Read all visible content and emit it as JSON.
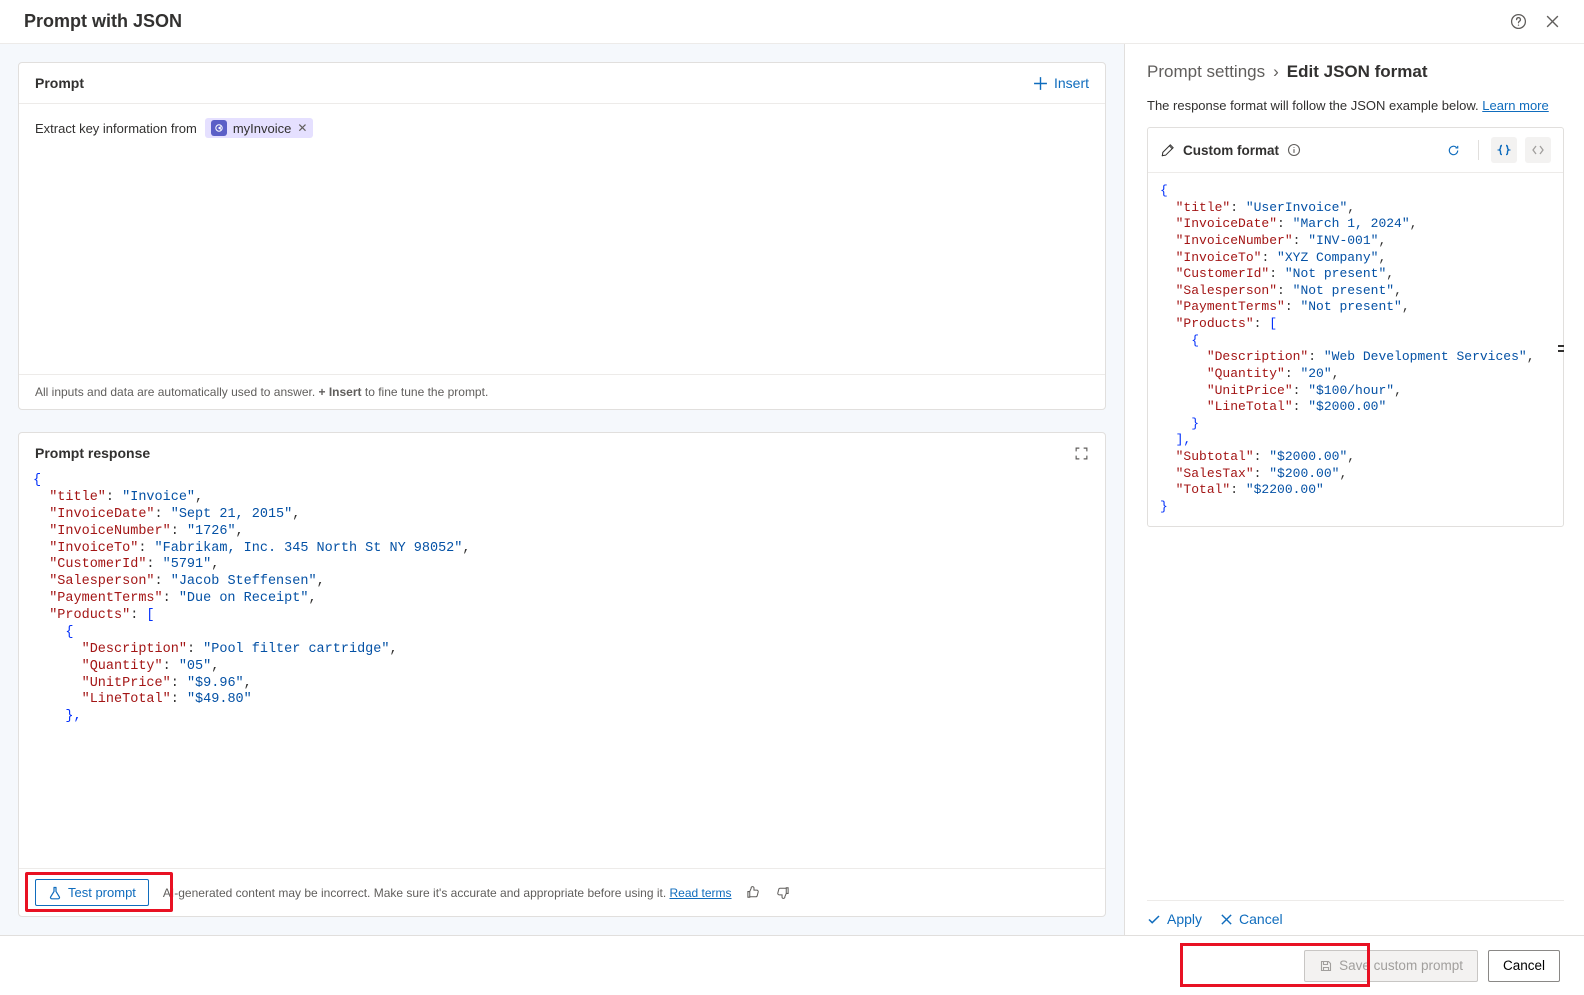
{
  "header": {
    "title": "Prompt with JSON"
  },
  "prompt": {
    "section_title": "Prompt",
    "insert_label": "Insert",
    "text_prefix": "Extract key information from",
    "chip_label": "myInvoice",
    "footer_pre": "All inputs and data are automatically used to answer. ",
    "footer_bold": "+ Insert",
    "footer_post": " to fine tune the prompt."
  },
  "response": {
    "section_title": "Prompt response",
    "test_button": "Test prompt",
    "disclaimer": "AI-generated content may be incorrect. Make sure it's accurate and appropriate before using it. ",
    "read_terms": "Read terms",
    "json_lines": [
      {
        "ind": 0,
        "t": "br",
        "v": "{"
      },
      {
        "ind": 1,
        "t": "kv",
        "k": "title",
        "v": "Invoice",
        "c": true
      },
      {
        "ind": 1,
        "t": "kv",
        "k": "InvoiceDate",
        "v": "Sept 21, 2015",
        "c": true
      },
      {
        "ind": 1,
        "t": "kv",
        "k": "InvoiceNumber",
        "v": "1726",
        "c": true
      },
      {
        "ind": 1,
        "t": "kv",
        "k": "InvoiceTo",
        "v": "Fabrikam, Inc. 345 North St NY 98052",
        "c": true
      },
      {
        "ind": 1,
        "t": "kv",
        "k": "CustomerId",
        "v": "5791",
        "c": true
      },
      {
        "ind": 1,
        "t": "kv",
        "k": "Salesperson",
        "v": "Jacob Steffensen",
        "c": true
      },
      {
        "ind": 1,
        "t": "kv",
        "k": "PaymentTerms",
        "v": "Due on Receipt",
        "c": true
      },
      {
        "ind": 1,
        "t": "karr",
        "k": "Products"
      },
      {
        "ind": 2,
        "t": "br",
        "v": "{"
      },
      {
        "ind": 3,
        "t": "kv",
        "k": "Description",
        "v": "Pool filter cartridge",
        "c": true
      },
      {
        "ind": 3,
        "t": "kv",
        "k": "Quantity",
        "v": "05",
        "c": true
      },
      {
        "ind": 3,
        "t": "kv",
        "k": "UnitPrice",
        "v": "$9.96",
        "c": true
      },
      {
        "ind": 3,
        "t": "kv",
        "k": "LineTotal",
        "v": "$49.80"
      },
      {
        "ind": 2,
        "t": "br",
        "v": "},"
      }
    ]
  },
  "right": {
    "breadcrumb_parent": "Prompt settings",
    "breadcrumb_current": "Edit JSON format",
    "desc": "The response format will follow the JSON example below. ",
    "learn_more": "Learn more",
    "format_title": "Custom format",
    "json_lines": [
      {
        "ind": 0,
        "t": "br",
        "v": "{"
      },
      {
        "ind": 1,
        "t": "kv",
        "k": "title",
        "v": "UserInvoice",
        "c": true
      },
      {
        "ind": 1,
        "t": "kv",
        "k": "InvoiceDate",
        "v": "March 1, 2024",
        "c": true
      },
      {
        "ind": 1,
        "t": "kv",
        "k": "InvoiceNumber",
        "v": "INV-001",
        "c": true
      },
      {
        "ind": 1,
        "t": "kv",
        "k": "InvoiceTo",
        "v": "XYZ Company",
        "c": true
      },
      {
        "ind": 1,
        "t": "kv",
        "k": "CustomerId",
        "v": "Not present",
        "c": true
      },
      {
        "ind": 1,
        "t": "kv",
        "k": "Salesperson",
        "v": "Not present",
        "c": true
      },
      {
        "ind": 1,
        "t": "kv",
        "k": "PaymentTerms",
        "v": "Not present",
        "c": true
      },
      {
        "ind": 1,
        "t": "karr",
        "k": "Products"
      },
      {
        "ind": 2,
        "t": "br",
        "v": "{"
      },
      {
        "ind": 3,
        "t": "kv",
        "k": "Description",
        "v": "Web Development Services",
        "c": true
      },
      {
        "ind": 3,
        "t": "kv",
        "k": "Quantity",
        "v": "20",
        "c": true
      },
      {
        "ind": 3,
        "t": "kv",
        "k": "UnitPrice",
        "v": "$100/hour",
        "c": true
      },
      {
        "ind": 3,
        "t": "kv",
        "k": "LineTotal",
        "v": "$2000.00"
      },
      {
        "ind": 2,
        "t": "br",
        "v": "}"
      },
      {
        "ind": 1,
        "t": "br",
        "v": "],"
      },
      {
        "ind": 1,
        "t": "kv",
        "k": "Subtotal",
        "v": "$2000.00",
        "c": true
      },
      {
        "ind": 1,
        "t": "kv",
        "k": "SalesTax",
        "v": "$200.00",
        "c": true
      },
      {
        "ind": 1,
        "t": "kv",
        "k": "Total",
        "v": "$2200.00"
      },
      {
        "ind": 0,
        "t": "br",
        "v": "}"
      }
    ],
    "apply_label": "Apply",
    "cancel_label": "Cancel"
  },
  "footer": {
    "save_label": "Save custom prompt",
    "cancel_label": "Cancel"
  }
}
